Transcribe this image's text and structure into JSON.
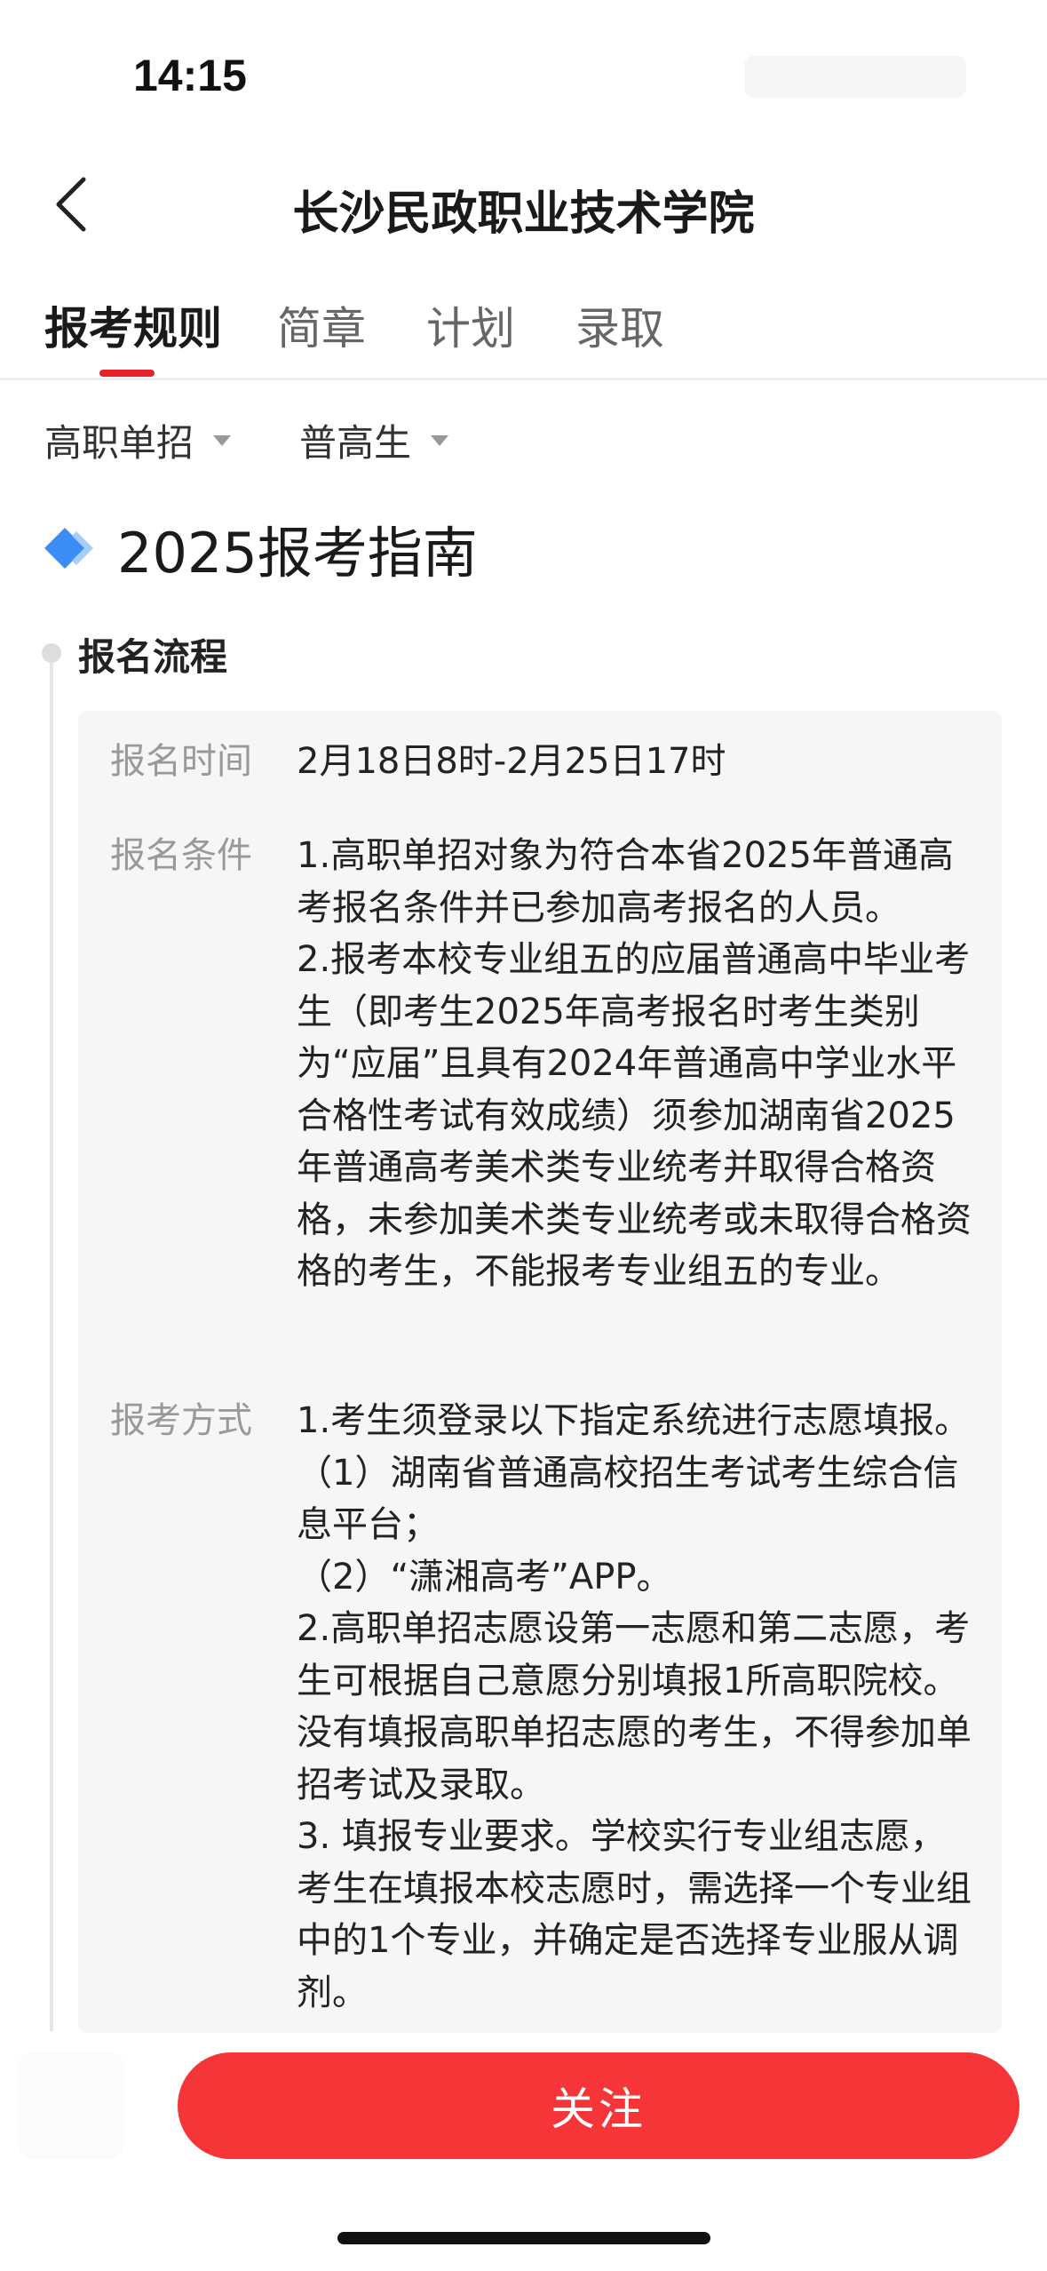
{
  "status_bar": {
    "time": "14:15"
  },
  "nav": {
    "title": "长沙民政职业技术学院"
  },
  "tabs": [
    {
      "label": "报考规则",
      "active": true
    },
    {
      "label": "简章",
      "active": false
    },
    {
      "label": "计划",
      "active": false
    },
    {
      "label": "录取",
      "active": false
    }
  ],
  "filters": [
    {
      "label": "高职单招"
    },
    {
      "label": "普高生"
    }
  ],
  "guide": {
    "title": "2025报考指南",
    "icon": "diamond-icon",
    "icon_colors": [
      "#3b8cf5",
      "#a9cdfb"
    ]
  },
  "section": {
    "title": "报名流程"
  },
  "rows": [
    {
      "label": "报名时间",
      "value": "2月18日8时-2月25日17时"
    },
    {
      "label": "报名条件",
      "value": "1.高职单招对象为符合本省2025年普通高考报名条件并已参加高考报名的人员。\n2.报考本校专业组五的应届普通高中毕业考生（即考生2025年高考报名时考生类别为“应届”且具有2024年普通高中学业水平合格性考试有效成绩）须参加湖南省2025年普通高考美术类专业统考并取得合格资格，未参加美术类专业统考或未取得合格资格的考生，不能报考专业组五的专业。"
    },
    {
      "label": "报考方式",
      "value": "1.考生须登录以下指定系统进行志愿填报。\n（1）湖南省普通高校招生考试考生综合信息平台；\n（2）“潇湘高考”APP。\n2.高职单招志愿设第一志愿和第二志愿，考生可根据自己意愿分别填报1所高职院校。没有填报高职单招志愿的考生，不得参加单招考试及录取。\n3. 填报专业要求。学校实行专业组志愿，考生在填报本校志愿时，需选择一个专业组中的1个专业，并确定是否选择专业服从调剂。"
    }
  ],
  "actions": {
    "follow_label": "关注"
  },
  "colors": {
    "accent": "#e8222a",
    "button": "#f53537"
  }
}
